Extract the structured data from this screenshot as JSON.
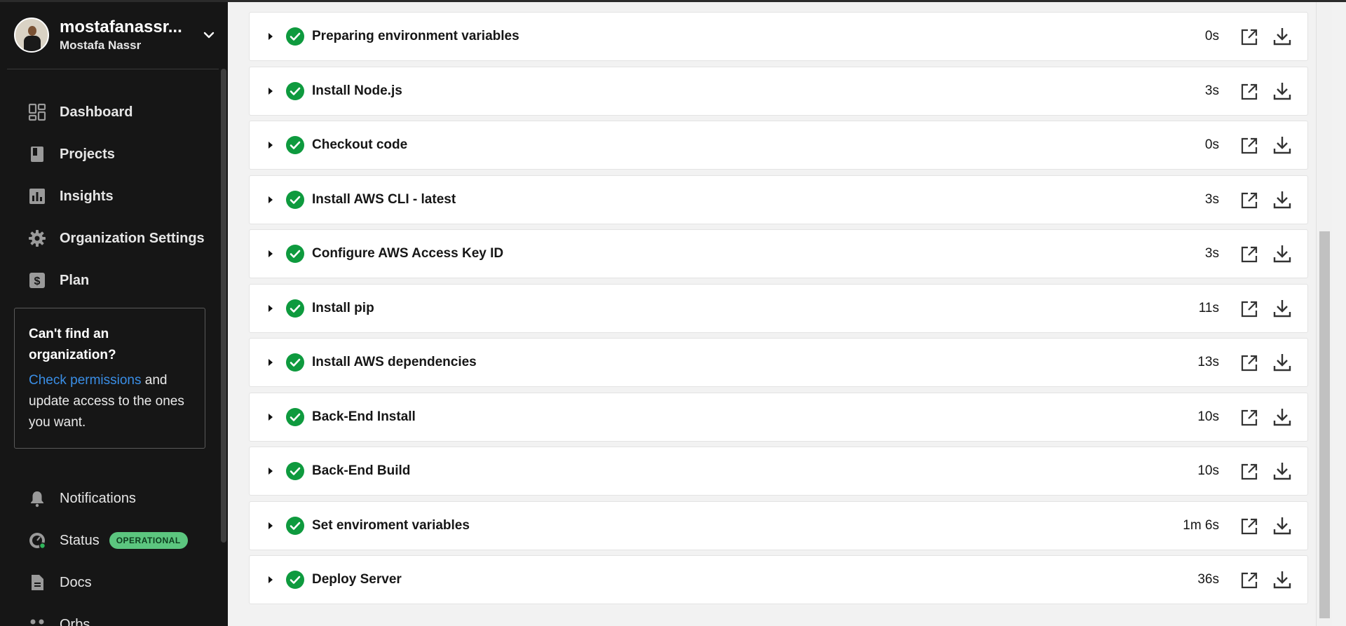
{
  "org": {
    "name": "mostafanassr...",
    "user": "Mostafa Nassr"
  },
  "nav": [
    {
      "label": "Dashboard",
      "icon": "dashboard-icon"
    },
    {
      "label": "Projects",
      "icon": "book-icon"
    },
    {
      "label": "Insights",
      "icon": "bar-chart-icon"
    },
    {
      "label": "Organization Settings",
      "icon": "gear-icon"
    },
    {
      "label": "Plan",
      "icon": "dollar-icon"
    }
  ],
  "help": {
    "title": "Can't find an organization?",
    "link": "Check permissions",
    "rest": " and update access to the ones you want."
  },
  "nav2": [
    {
      "label": "Notifications",
      "icon": "bell-icon"
    },
    {
      "label": "Status",
      "icon": "speedometer-icon",
      "badge": "OPERATIONAL"
    },
    {
      "label": "Docs",
      "icon": "document-icon"
    },
    {
      "label": "Orbs",
      "icon": "orbs-icon"
    }
  ],
  "steps": [
    {
      "name": "Preparing environment variables",
      "duration": "0s"
    },
    {
      "name": "Install Node.js",
      "duration": "3s"
    },
    {
      "name": "Checkout code",
      "duration": "0s"
    },
    {
      "name": "Install AWS CLI - latest",
      "duration": "3s"
    },
    {
      "name": "Configure AWS Access Key ID",
      "duration": "3s"
    },
    {
      "name": "Install pip",
      "duration": "11s"
    },
    {
      "name": "Install AWS dependencies",
      "duration": "13s"
    },
    {
      "name": "Back-End Install",
      "duration": "10s"
    },
    {
      "name": "Back-End Build",
      "duration": "10s"
    },
    {
      "name": "Set enviroment variables",
      "duration": "1m 6s"
    },
    {
      "name": "Deploy Server",
      "duration": "36s"
    }
  ],
  "colors": {
    "success": "#0e9a3e",
    "link": "#3a8ee6",
    "badge": "#5cc67f",
    "sidebar": "#161616"
  }
}
